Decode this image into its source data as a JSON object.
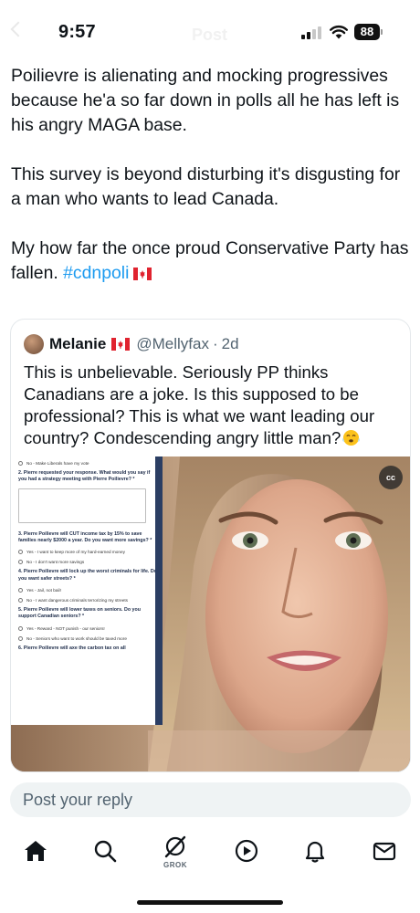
{
  "status_bar": {
    "time": "9:57",
    "battery": "88",
    "faded_title": "Post"
  },
  "post": {
    "paragraphs": [
      "Poilievre is alienating and mocking progressives because he'a so far down in polls all he has left is his angry MAGA base.",
      "This survey is beyond disturbing it's disgusting for a man who wants to lead Canada.",
      "My how far the once proud Conservative Party has fallen."
    ],
    "hashtag": "#cdnpoli",
    "flag_icon": "canada-flag-icon"
  },
  "quote": {
    "author_name": "Melanie",
    "handle": "@Mellyfax",
    "separator": "·",
    "time": "2d",
    "text": "This is unbelievable.  Seriously PP thinks Canadians are a joke.  Is this supposed to be professional?  This is what we want leading our country? Condescending angry little man?",
    "emoji": "face-with-steam-from-nose",
    "media": {
      "cc_label": "cc",
      "survey": {
        "top_option": "No - Make Liberals have my vote",
        "q2": "2. Pierre requested your response. What would you say if you had a strategy meeting with Pierre Poilievre? *",
        "q3": "3. Pierre Poilievre will CUT income tax by 15% to save families nearly $2000 a year. Do you want more savings? *",
        "q3_options": [
          "Yes - I want to keep more of my hard-earned money",
          "No - I don't want more savings"
        ],
        "q4": "4. Pierre Poilievre will lock up the worst criminals for life. Do you want safer streets? *",
        "q4_options": [
          "Yes - Jail, not bail!",
          "No - I want dangerous criminals terrorizing my streets"
        ],
        "q5": "5. Pierre Poilievre will lower taxes on seniors. Do you support Canadian seniors? *",
        "q5_options": [
          "Yes - Reward - NOT punish - our seniors!",
          "No - Seniors who want to work should be taxed more"
        ],
        "q6": "6. Pierre Poilievre will axe the carbon tax on all"
      }
    }
  },
  "reply": {
    "placeholder": "Post your reply"
  },
  "nav": {
    "items": [
      "home-icon",
      "search-icon",
      "grok-icon",
      "video-icon",
      "notifications-icon",
      "messages-icon"
    ],
    "grok_label": "GROK"
  },
  "colors": {
    "accent": "#1d9bf0",
    "text": "#0f1419",
    "secondary": "#536471"
  }
}
